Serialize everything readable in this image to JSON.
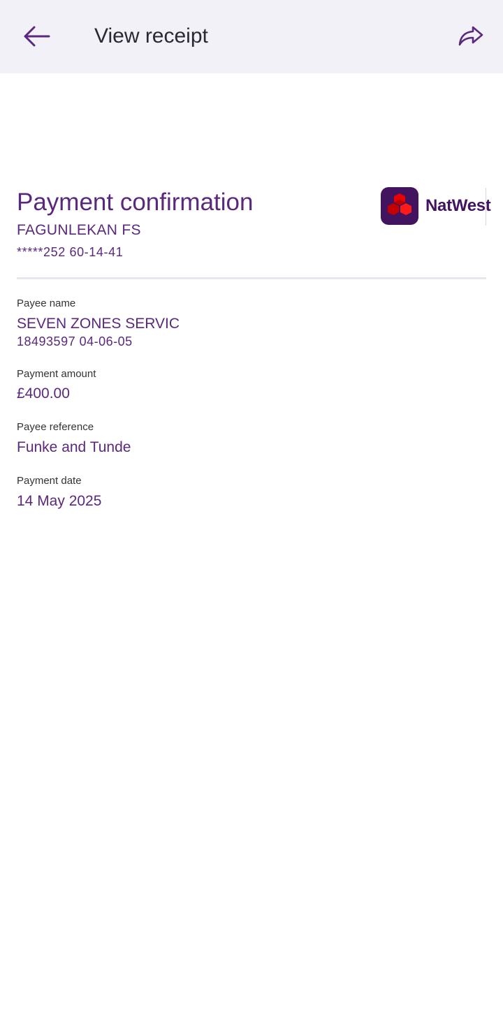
{
  "header": {
    "title": "View receipt",
    "back_icon": "arrow-left-icon",
    "share_icon": "share-arrow-icon"
  },
  "receipt": {
    "title": "Payment confirmation",
    "account_name": "FAGUNLEKAN FS",
    "account_number": "*****252 60-14-41",
    "brand": "NatWest"
  },
  "fields": {
    "payee_name": {
      "label": "Payee name",
      "value": "SEVEN ZONES SERVIC",
      "sub": "18493597 04-06-05"
    },
    "payment_amount": {
      "label": "Payment amount",
      "value": "£400.00"
    },
    "payee_reference": {
      "label": "Payee reference",
      "value": "Funke  and Tunde"
    },
    "payment_date": {
      "label": "Payment date",
      "value": "14 May 2025"
    }
  },
  "colors": {
    "header_bg": "#f2f1f7",
    "accent_purple": "#5a287d",
    "brand_purple": "#42145f",
    "brand_red": "#e90000",
    "divider": "#e8e6ec"
  }
}
